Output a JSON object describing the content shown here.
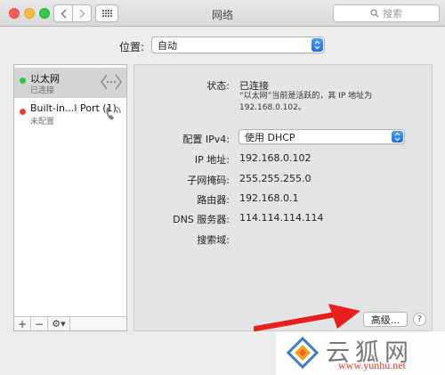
{
  "window": {
    "title": "网络"
  },
  "toolbar": {
    "search_placeholder": "搜索"
  },
  "location": {
    "label": "位置:",
    "value": "自动"
  },
  "services": [
    {
      "name": "以太网",
      "status": "已连接",
      "status_color": "#28c840",
      "icon": "ethernet-icon"
    },
    {
      "name": "Built-in...l Port (1)",
      "status": "未配置",
      "status_color": "#ee3b33",
      "icon": "phone-port-icon"
    }
  ],
  "sidebar_toolbar": {
    "add": "+",
    "remove": "−",
    "gear": "⚙▾"
  },
  "detail": {
    "status_label": "状态:",
    "status_value": "已连接",
    "status_desc": "“以太网”当前是活跃的，其 IP 地址为 192.168.0.102。",
    "ipv4_label": "配置 IPv4:",
    "ipv4_value": "使用 DHCP",
    "ip_label": "IP 地址:",
    "ip_value": "192.168.0.102",
    "subnet_label": "子网掩码:",
    "subnet_value": "255.255.255.0",
    "router_label": "路由器:",
    "router_value": "192.168.0.1",
    "dns_label": "DNS 服务器:",
    "dns_value": "114.114.114.114",
    "search_domain_label": "搜索域:",
    "advanced_button": "高级...",
    "help_button": "?"
  },
  "watermark": {
    "brand": "云狐网",
    "url": "www.yunhu.net"
  }
}
